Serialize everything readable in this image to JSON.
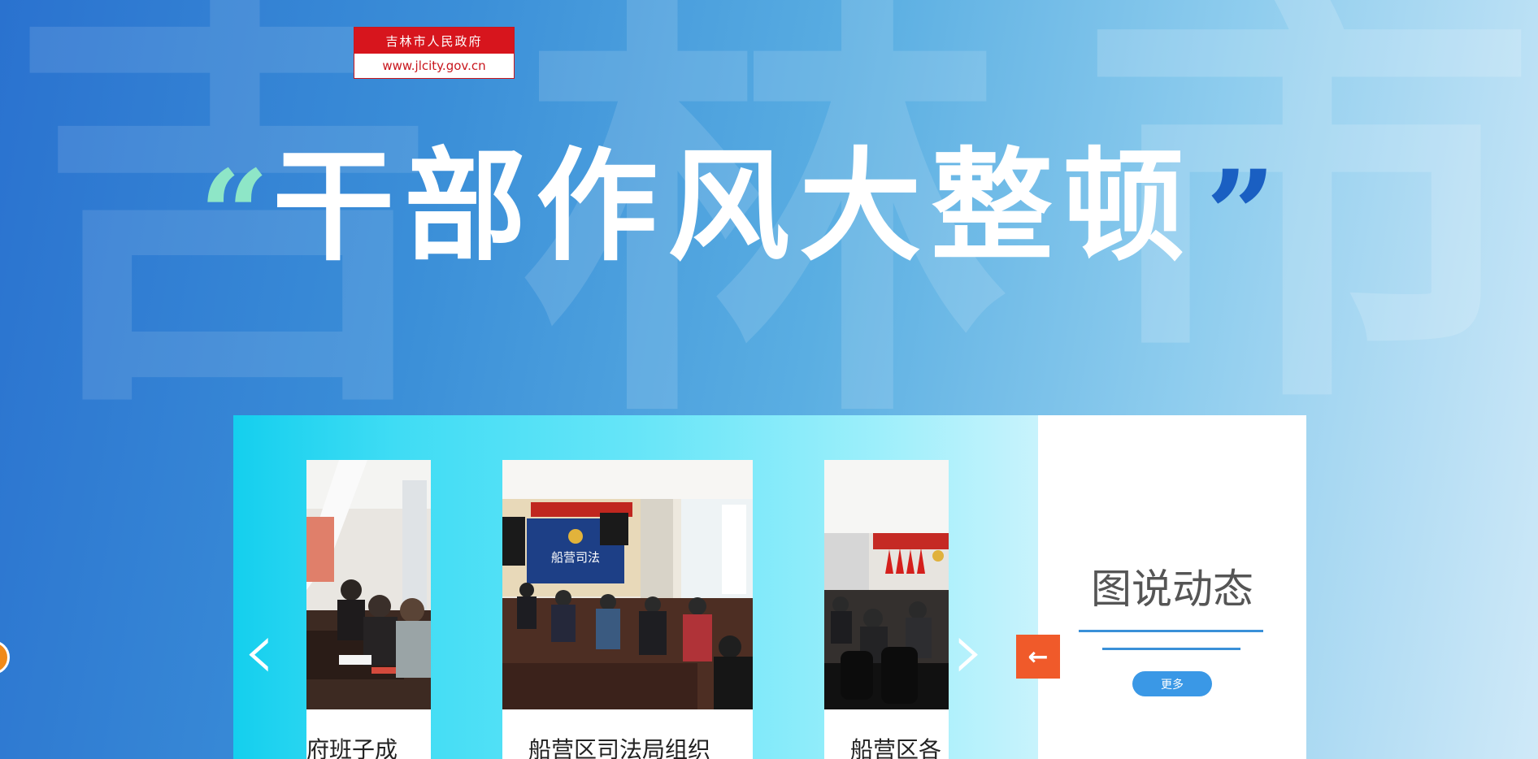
{
  "background": {
    "watermark_chars": [
      "吉",
      "林",
      "市"
    ]
  },
  "logo": {
    "title": "吉林市人民政府",
    "url": "www.jlcity.gov.cn"
  },
  "headline": {
    "open_quote": "“",
    "text": "干部作风大整顿",
    "close_quote": "”"
  },
  "slider": {
    "prev_icon": "chevron-left-icon",
    "next_icon": "chevron-right-icon",
    "prev_glyph": "‹",
    "next_glyph": "›",
    "cards": [
      {
        "caption": "府班子成"
      },
      {
        "caption": "船营区司法局组织"
      },
      {
        "caption": "船营区各"
      }
    ],
    "back_icon": "arrow-left-icon",
    "back_glyph": "←"
  },
  "side_panel": {
    "title": "图说动态",
    "more_label": "更多"
  },
  "colors": {
    "accent_blue": "#3a98e6",
    "back_button": "#f05a2a",
    "logo_red": "#d7151d",
    "quote_open": "#8ee6c7",
    "quote_close": "#1a5fc2"
  }
}
